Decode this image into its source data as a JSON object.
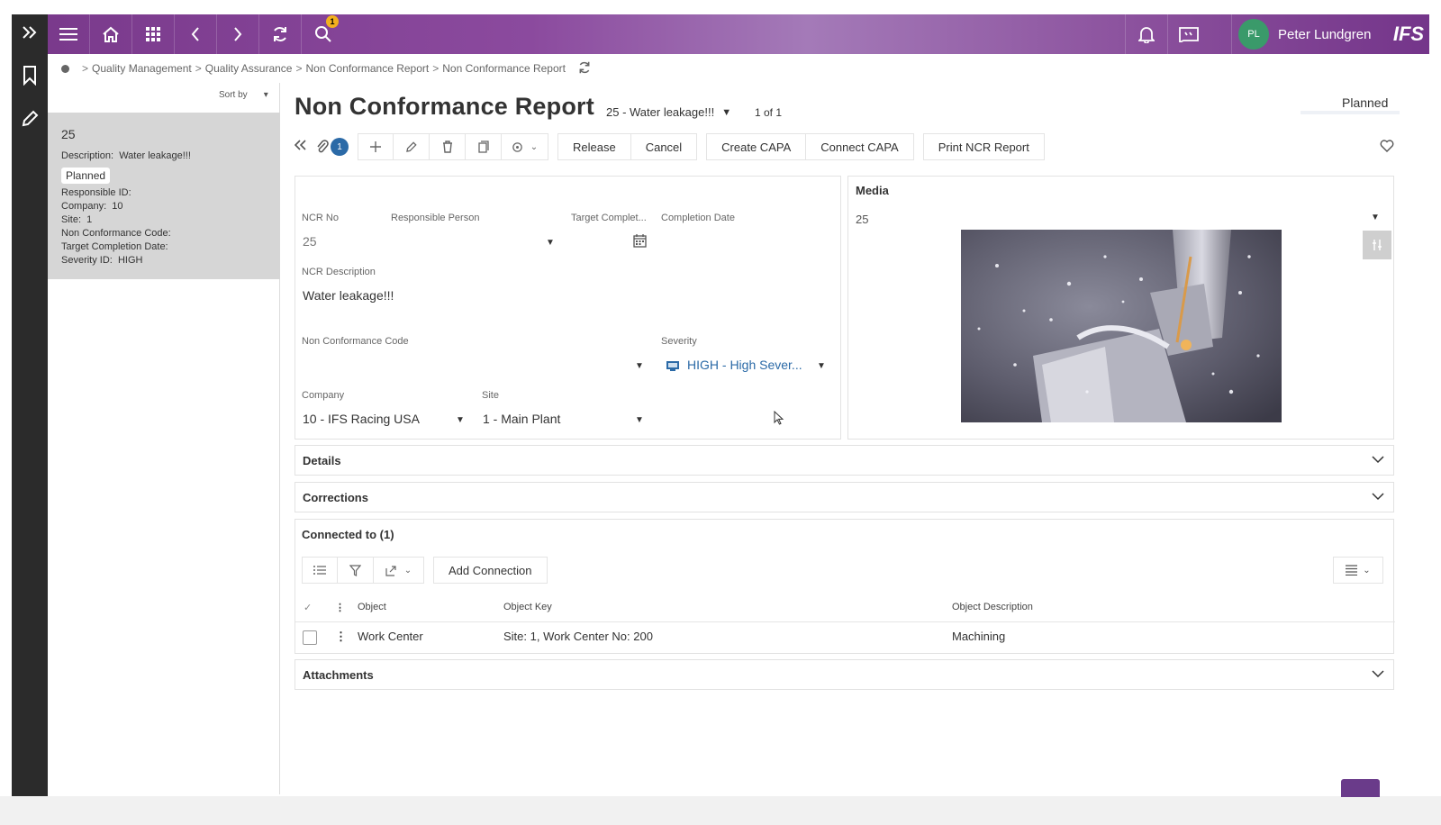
{
  "topbar": {
    "notifications_badge": "1",
    "user_initials": "PL",
    "user_name": "Peter Lundgren",
    "logo": "IFS"
  },
  "breadcrumb": {
    "items": [
      "Quality Management",
      "Quality Assurance",
      "Non Conformance Report",
      "Non Conformance Report"
    ],
    "separator": ">"
  },
  "list": {
    "sort_label": "Sort by",
    "record": {
      "number": "25",
      "description_label": "Description:",
      "description": "Water leakage!!!",
      "status": "Planned",
      "responsible_id": "Responsible ID:",
      "company_label": "Company:",
      "company": "10",
      "site_label": "Site:",
      "site": "1",
      "nc_code": "Non Conformance Code:",
      "target_completion": "Target Completion Date:",
      "severity_label": "Severity ID:",
      "severity": "HIGH"
    }
  },
  "header": {
    "title": "Non Conformance Report",
    "record_selector": "25 - Water leakage!!!",
    "paging": "1 of 1",
    "status": "Planned"
  },
  "toolbar": {
    "attachments_count": "1",
    "release": "Release",
    "cancel": "Cancel",
    "create_capa": "Create CAPA",
    "connect_capa": "Connect CAPA",
    "print_ncr": "Print NCR Report"
  },
  "form": {
    "ncr_no_label": "NCR No",
    "ncr_no": "25",
    "responsible_label": "Responsible Person",
    "target_label": "Target Complet...",
    "completion_label": "Completion Date",
    "description_label": "NCR Description",
    "description": "Water leakage!!!",
    "nc_code_label": "Non Conformance Code",
    "severity_label": "Severity",
    "severity": "HIGH - High Sever...",
    "company_label": "Company",
    "company": "10 - IFS Racing USA",
    "site_label": "Site",
    "site": "1 - Main Plant"
  },
  "media": {
    "title": "Media",
    "selected": "25"
  },
  "sections": {
    "details": "Details",
    "corrections": "Corrections",
    "attachments": "Attachments"
  },
  "connected": {
    "title": "Connected to (1)",
    "add_connection": "Add Connection",
    "columns": [
      "Object",
      "Object Key",
      "Object Description"
    ],
    "rows": [
      {
        "object": "Work Center",
        "key": "Site: 1, Work Center No: 200",
        "description": "Machining"
      }
    ]
  },
  "colors": {
    "topbar_purple": "#7a3a8c",
    "rail_dark": "#2b2b2b",
    "link_blue": "#2b6aa7"
  }
}
